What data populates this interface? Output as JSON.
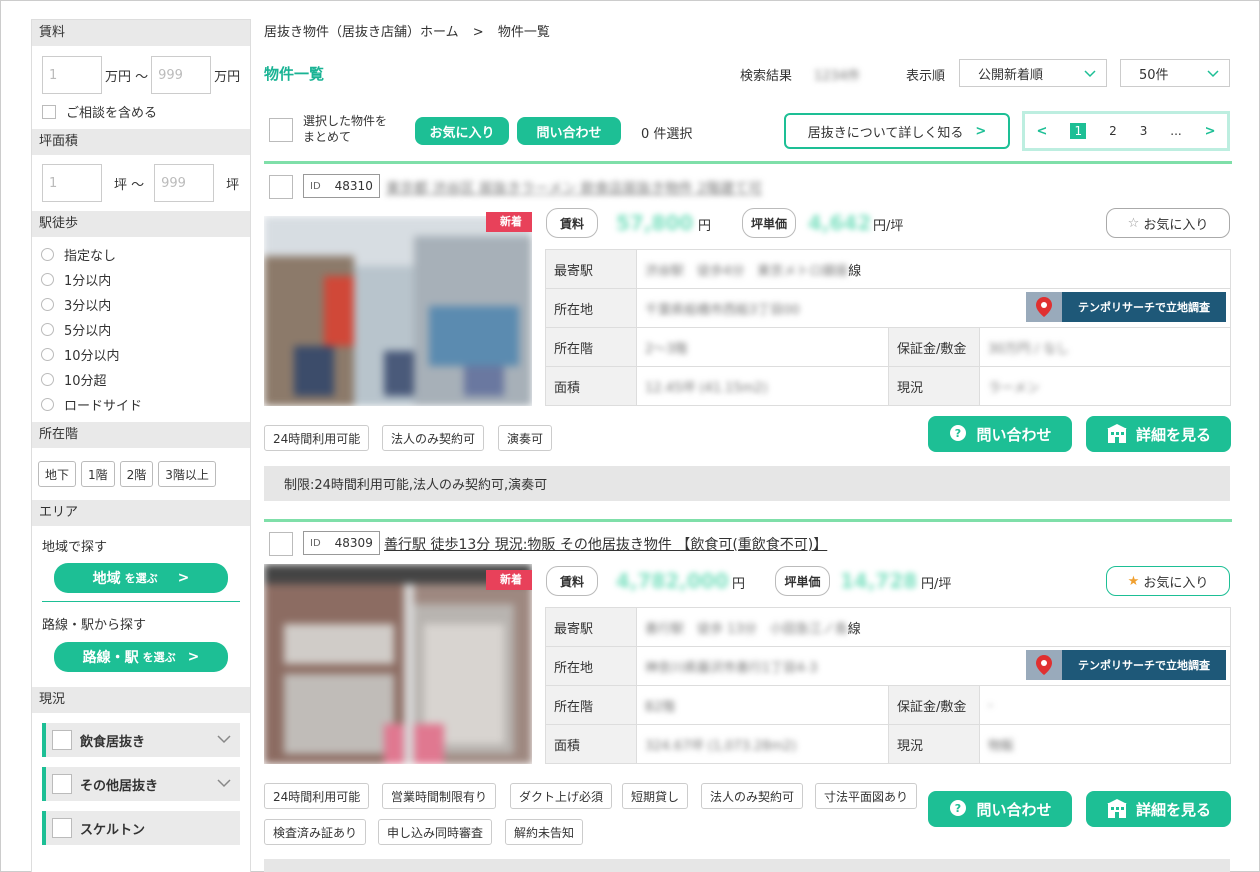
{
  "sidebar": {
    "rent": {
      "heading": "賃料",
      "min_placeholder": "1",
      "min_unit": "万円 〜",
      "max_placeholder": "999",
      "max_unit": "万円",
      "consult_label": "ご相談を含める"
    },
    "area": {
      "heading": "坪面積",
      "min_placeholder": "1",
      "min_unit": "坪 〜",
      "max_placeholder": "999",
      "max_unit": "坪"
    },
    "walk": {
      "heading": "駅徒歩",
      "options": [
        "指定なし",
        "1分以内",
        "3分以内",
        "5分以内",
        "10分以内",
        "10分超",
        "ロードサイド"
      ]
    },
    "floor": {
      "heading": "所在階",
      "options": [
        "地下",
        "1階",
        "2階",
        "3階以上"
      ]
    },
    "region": {
      "heading": "エリア",
      "by_region_label": "地域で探す",
      "region_btn_main": "地域",
      "region_btn_sub": "を選ぶ",
      "by_line_label": "路線・駅から探す",
      "line_btn_main": "路線・駅",
      "line_btn_sub": "を選ぶ"
    },
    "status": {
      "heading": "現況",
      "categories": [
        "飲食居抜き",
        "その他居抜き",
        "スケルトン"
      ]
    }
  },
  "header": {
    "breadcrumb_home": "居抜き物件（居抜き店舗）ホーム",
    "breadcrumb_sep": ">",
    "breadcrumb_current": "物件一覧",
    "title": "物件一覧",
    "result_label": "検索結果",
    "result_count": "1234件",
    "sort_label": "表示順",
    "sort_value": "公開新着順",
    "per_page_value": "50件"
  },
  "bulk": {
    "select_label_1": "選択した物件を",
    "select_label_2": "まとめて",
    "fav_btn": "お気に入り",
    "contact_btn": "問い合わせ",
    "selected_count": "0 件選択",
    "learn_btn": "居抜きについて詳しく知る"
  },
  "pager": {
    "pages": [
      "1",
      "2",
      "3",
      "..."
    ]
  },
  "listings": [
    {
      "id_label": "ID",
      "id": "48310",
      "title": "東京都 渋谷区 居抜きラーメン 飲食店居抜き物件 2階建て可",
      "new_tag": "新着",
      "rent_label": "賃料",
      "rent_value": "57,800",
      "rent_unit": "円",
      "unit_label": "坪単価",
      "unit_value": "4,642",
      "unit_unit": "円/坪",
      "fav_label": "お気に入り",
      "station_label": "最寄駅",
      "station_value": "渋谷駅　徒歩4分　東京メトロ銀座",
      "station_suffix": "線",
      "address_label": "所在地",
      "address_value": "千葉県船橋市西船3丁目00",
      "tempo_label": "テンポリサーチで立地調査",
      "floor_label": "所在階",
      "floor_value": "2〜3階",
      "deposit_label": "保証金/敷金",
      "deposit_value": "30万円 / なし",
      "area_label": "面積",
      "area_value": "12.45坪 (41.15m2)",
      "status_label": "現況",
      "status_value": "ラーメン",
      "tags": [
        "24時間利用可能",
        "法人のみ契約可",
        "演奏可"
      ],
      "contact_btn": "問い合わせ",
      "detail_btn": "詳細を見る",
      "restriction": "制限:24時間利用可能,法人のみ契約可,演奏可"
    },
    {
      "id_label": "ID",
      "id": "48309",
      "title": "善行駅 徒歩13分 現況:物販 その他居抜き物件 【飲食可(重飲食不可)】",
      "new_tag": "新着",
      "rent_label": "賃料",
      "rent_value": "4,782,000",
      "rent_unit": "円",
      "unit_label": "坪単価",
      "unit_value": "14,728",
      "unit_unit": "円/坪",
      "fav_label": "お気に入り",
      "station_label": "最寄駅",
      "station_value": "善行駅　徒歩 13分　小田急江ノ島",
      "station_suffix": "線",
      "address_label": "所在地",
      "address_value": "神奈川県藤沢市善行1丁目4-3",
      "tempo_label": "テンポリサーチで立地調査",
      "floor_label": "所在階",
      "floor_value": "B2階",
      "deposit_label": "保証金/敷金",
      "deposit_value": "-",
      "area_label": "面積",
      "area_value": "324.67坪 (1,073.28m2)",
      "status_label": "現況",
      "status_value": "物販",
      "tags": [
        "24時間利用可能",
        "営業時間制限有り",
        "ダクト上げ必須",
        "短期貸し",
        "法人のみ契約可",
        "寸法平面図あり",
        "検査済み証あり",
        "申し込み同時審査",
        "解約未告知"
      ],
      "contact_btn": "問い合わせ",
      "detail_btn": "詳細を見る"
    }
  ]
}
